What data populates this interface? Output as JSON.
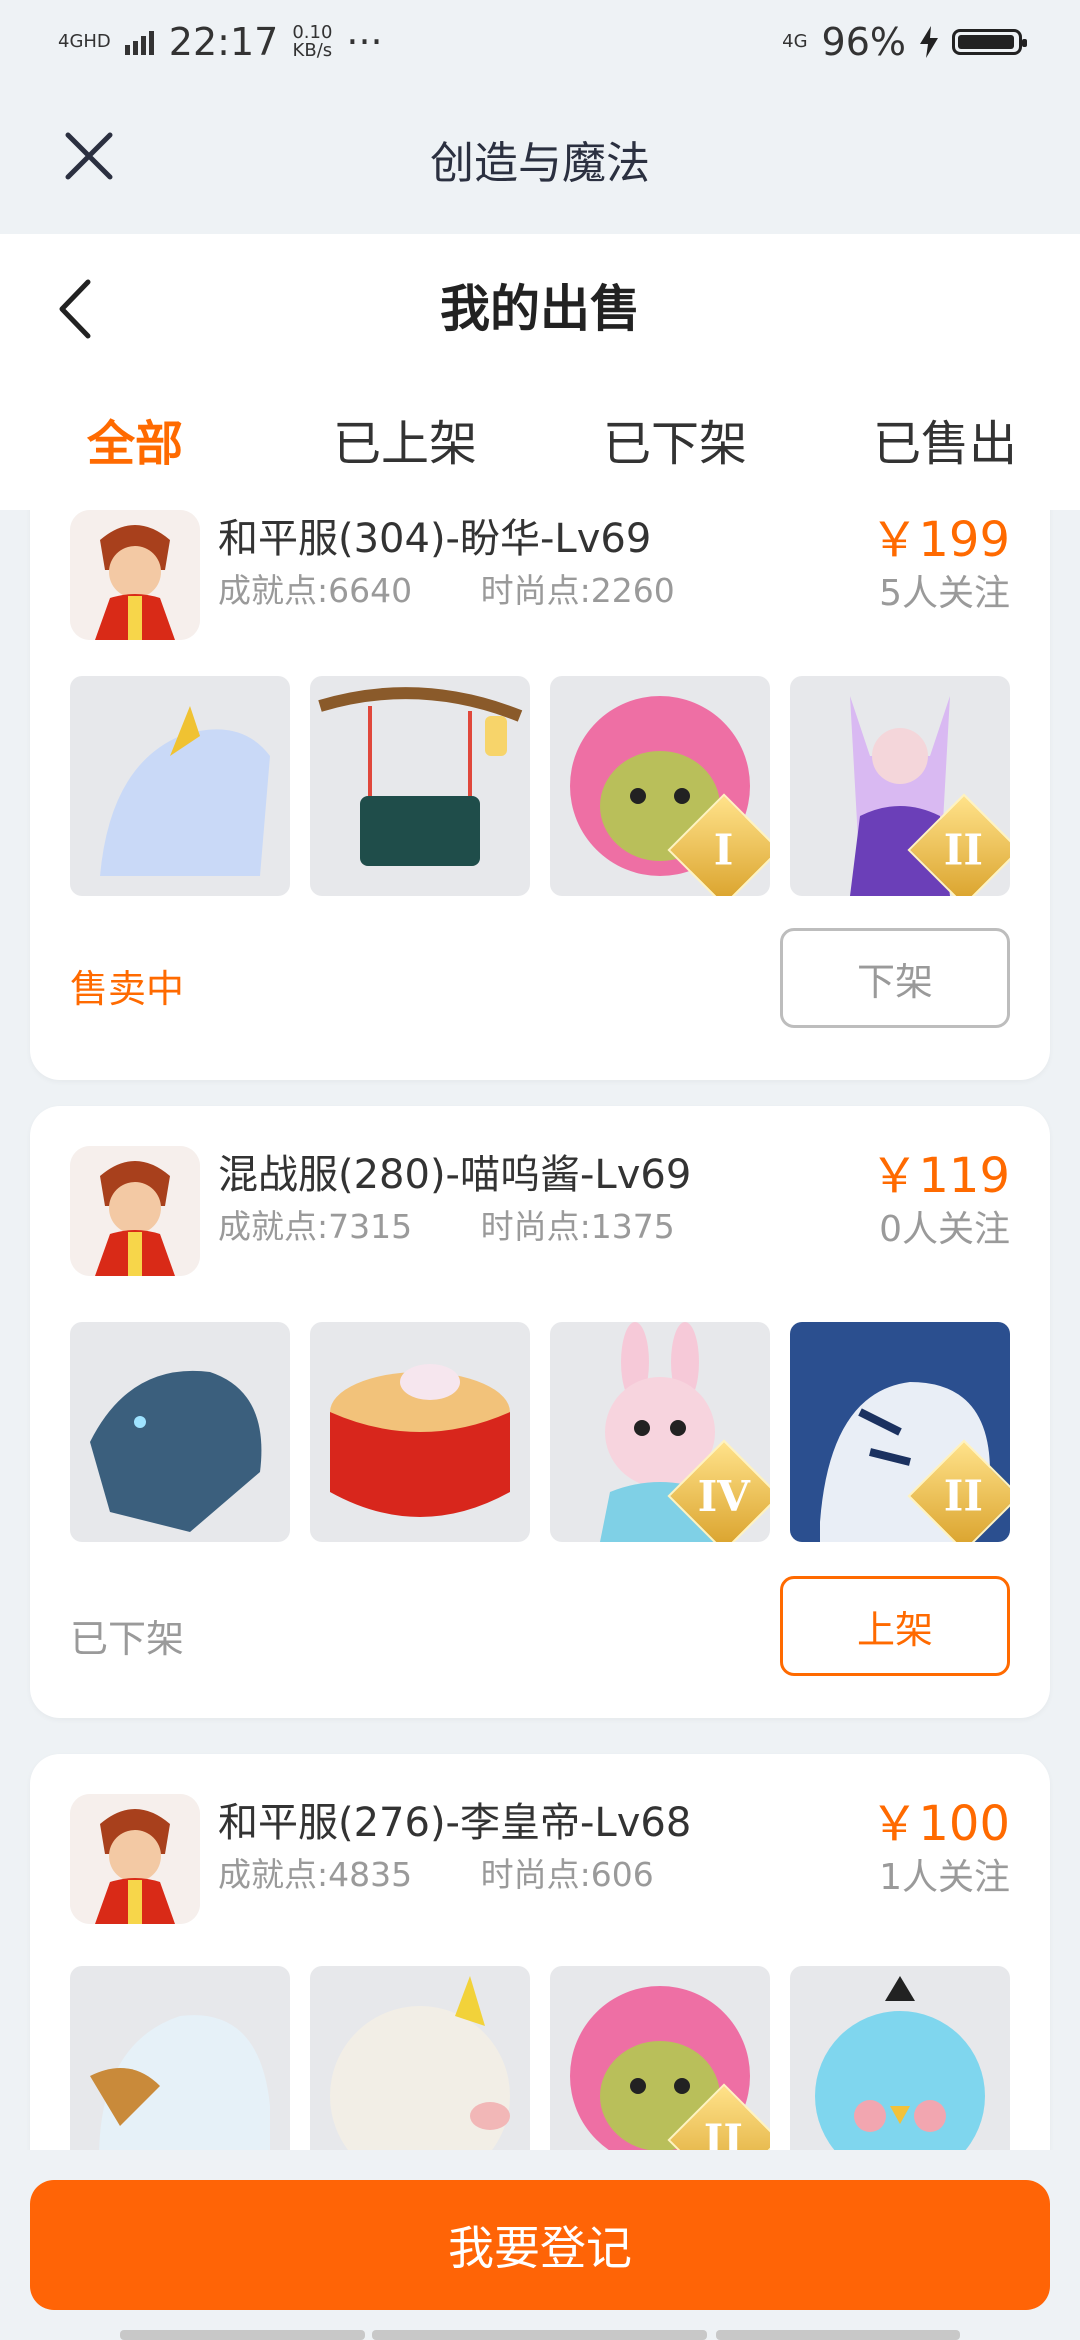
{
  "status": {
    "network": "4GHD",
    "time": "22:17",
    "speed_value": "0.10",
    "speed_unit": "KB/s",
    "dots": "···",
    "net2": "4G",
    "battery": "96%"
  },
  "titlebar": {
    "title": "创造与魔法"
  },
  "header": {
    "title": "我的出售"
  },
  "tabs": [
    {
      "label": "全部"
    },
    {
      "label": "已上架"
    },
    {
      "label": "已下架"
    },
    {
      "label": "已售出"
    }
  ],
  "accent": "#ff6a00",
  "listings": [
    {
      "name": "和平服(304)-盼华-Lv69",
      "achievement": "成就点:6640",
      "fashion": "时尚点:2260",
      "price": "￥199",
      "follow": "5人关注",
      "state": "售卖中",
      "action": "下架",
      "thumbs": [
        {
          "icon": "ice-horse-mount-icon",
          "badge": ""
        },
        {
          "icon": "swing-chair-icon",
          "badge": ""
        },
        {
          "icon": "pink-bear-pet-icon",
          "badge": "I"
        },
        {
          "icon": "fox-spirit-icon",
          "badge": "II"
        }
      ]
    },
    {
      "name": "混战服(280)-喵呜酱-Lv69",
      "achievement": "成就点:7315",
      "fashion": "时尚点:1375",
      "price": "￥119",
      "follow": "0人关注",
      "state": "已下架",
      "action": "上架",
      "thumbs": [
        {
          "icon": "ice-dragon-icon",
          "badge": ""
        },
        {
          "icon": "red-drum-icon",
          "badge": ""
        },
        {
          "icon": "bunny-pet-icon",
          "badge": "IV"
        },
        {
          "icon": "white-tiger-icon",
          "badge": "II"
        }
      ]
    },
    {
      "name": "和平服(276)-李皇帝-Lv68",
      "achievement": "成就点:4835",
      "fashion": "时尚点:606",
      "price": "￥100",
      "follow": "1人关注",
      "state": "",
      "action": "",
      "thumbs": [
        {
          "icon": "eagle-mount-icon",
          "badge": ""
        },
        {
          "icon": "unicorn-pig-icon",
          "badge": ""
        },
        {
          "icon": "pink-bear-pet-icon",
          "badge": "II"
        },
        {
          "icon": "blue-bird-pet-icon",
          "badge": ""
        }
      ]
    }
  ],
  "bottom": {
    "button": "我要登记"
  }
}
